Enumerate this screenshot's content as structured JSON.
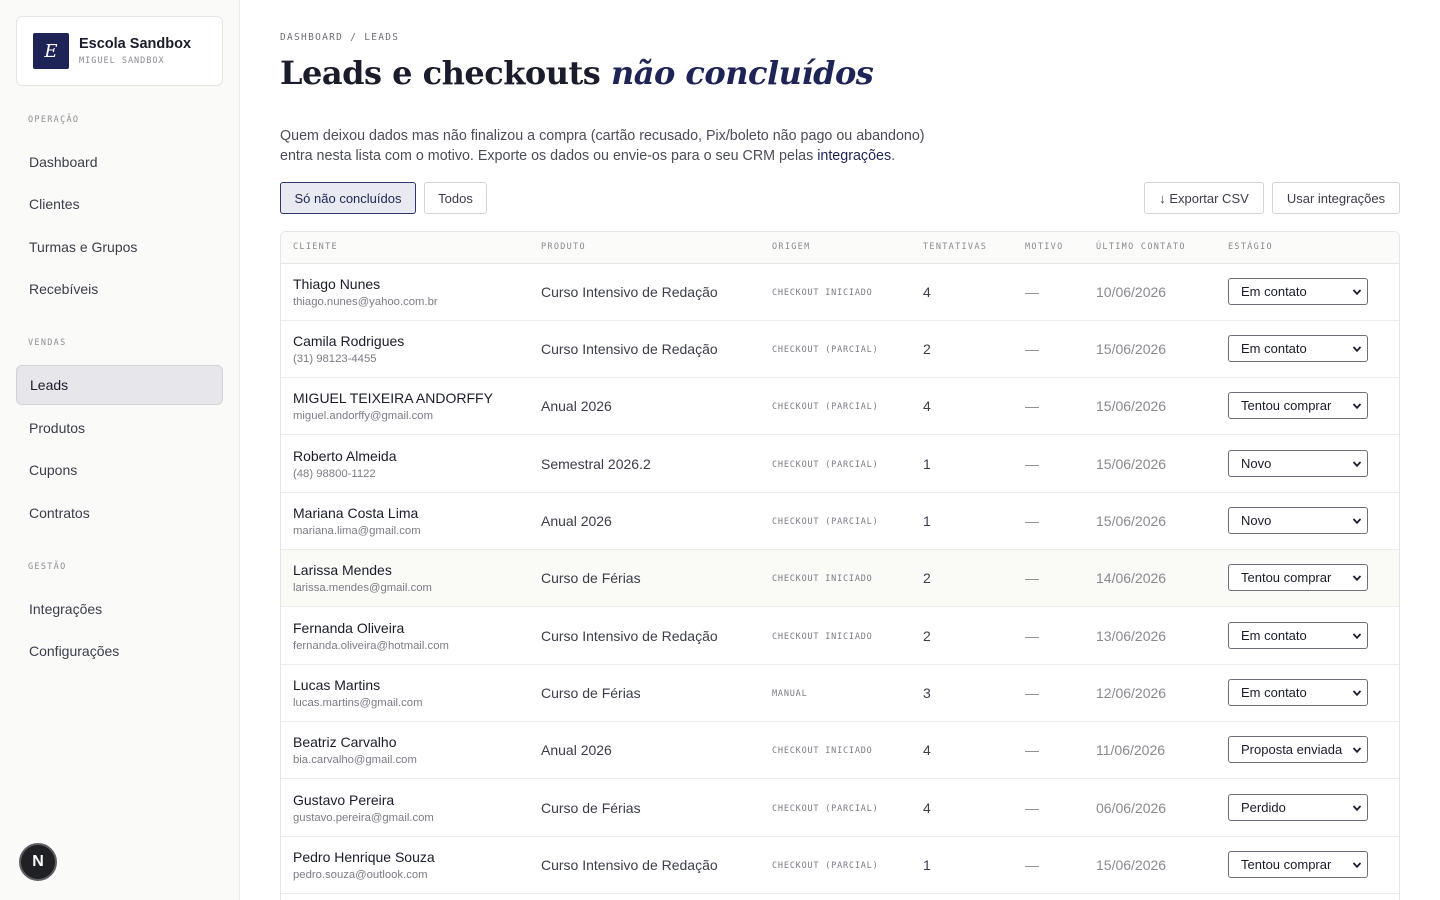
{
  "brand": {
    "initial": "E",
    "name": "Escola Sandbox",
    "sub": "MIGUEL SANDBOX"
  },
  "nav": {
    "sections": [
      {
        "label": "OPERAÇÃO",
        "items": [
          "Dashboard",
          "Clientes",
          "Turmas e Grupos",
          "Recebíveis"
        ]
      },
      {
        "label": "VENDAS",
        "items": [
          "Leads",
          "Produtos",
          "Cupons",
          "Contratos"
        ]
      },
      {
        "label": "GESTÃO",
        "items": [
          "Integrações",
          "Configurações"
        ]
      }
    ],
    "active": "Leads"
  },
  "fab": {
    "label": "N"
  },
  "page": {
    "breadcrumb": "DASHBOARD / LEADS",
    "title_main": "Leads e checkouts ",
    "title_em": "não concluídos",
    "desc_line1": "Quem deixou dados mas não finalizou a compra (cartão recusado, Pix/boleto não pago ou abandono)",
    "desc_line2": "entra nesta lista com o motivo. Exporte os dados ou envie-os para o seu CRM pelas ",
    "desc_link": "integrações",
    "desc_end": "."
  },
  "filters": {
    "only_unfinished": "Só não concluídos",
    "all": "Todos"
  },
  "actions": {
    "export": "↓ Exportar CSV",
    "integrations": "Usar integrações"
  },
  "table": {
    "headers": [
      "CLIENTE",
      "PRODUTO",
      "ORIGEM",
      "TENTATIVAS",
      "MOTIVO",
      "ÚLTIMO CONTATO",
      "ESTÁGIO"
    ],
    "rows": [
      {
        "name": "Thiago Nunes",
        "contact": "thiago.nunes@yahoo.com.br",
        "product": "Curso Intensivo de Redação",
        "origin": "CHECKOUT INICIADO",
        "attempts": "4",
        "reason": "—",
        "last": "10/06/2026",
        "stage": "Em contato"
      },
      {
        "name": "Camila Rodrigues",
        "contact": "(31) 98123-4455",
        "product": "Curso Intensivo de Redação",
        "origin": "CHECKOUT (PARCIAL)",
        "attempts": "2",
        "reason": "—",
        "last": "15/06/2026",
        "stage": "Em contato"
      },
      {
        "name": "MIGUEL TEIXEIRA ANDORFFY",
        "contact": "miguel.andorffy@gmail.com",
        "product": "Anual 2026",
        "origin": "CHECKOUT (PARCIAL)",
        "attempts": "4",
        "reason": "—",
        "last": "15/06/2026",
        "stage": "Tentou comprar"
      },
      {
        "name": "Roberto Almeida",
        "contact": "(48) 98800-1122",
        "product": "Semestral 2026.2",
        "origin": "CHECKOUT (PARCIAL)",
        "attempts": "1",
        "reason": "—",
        "last": "15/06/2026",
        "stage": "Novo"
      },
      {
        "name": "Mariana Costa Lima",
        "contact": "mariana.lima@gmail.com",
        "product": "Anual 2026",
        "origin": "CHECKOUT (PARCIAL)",
        "attempts": "1",
        "reason": "—",
        "last": "15/06/2026",
        "stage": "Novo"
      },
      {
        "name": "Larissa Mendes",
        "contact": "larissa.mendes@gmail.com",
        "product": "Curso de Férias",
        "origin": "CHECKOUT INICIADO",
        "attempts": "2",
        "reason": "—",
        "last": "14/06/2026",
        "stage": "Tentou comprar"
      },
      {
        "name": "Fernanda Oliveira",
        "contact": "fernanda.oliveira@hotmail.com",
        "product": "Curso Intensivo de Redação",
        "origin": "CHECKOUT INICIADO",
        "attempts": "2",
        "reason": "—",
        "last": "13/06/2026",
        "stage": "Em contato"
      },
      {
        "name": "Lucas Martins",
        "contact": "lucas.martins@gmail.com",
        "product": "Curso de Férias",
        "origin": "MANUAL",
        "attempts": "3",
        "reason": "—",
        "last": "12/06/2026",
        "stage": "Em contato"
      },
      {
        "name": "Beatriz Carvalho",
        "contact": "bia.carvalho@gmail.com",
        "product": "Anual 2026",
        "origin": "CHECKOUT INICIADO",
        "attempts": "4",
        "reason": "—",
        "last": "11/06/2026",
        "stage": "Proposta enviada"
      },
      {
        "name": "Gustavo Pereira",
        "contact": "gustavo.pereira@gmail.com",
        "product": "Curso de Férias",
        "origin": "CHECKOUT (PARCIAL)",
        "attempts": "4",
        "reason": "—",
        "last": "06/06/2026",
        "stage": "Perdido"
      },
      {
        "name": "Pedro Henrique Souza",
        "contact": "pedro.souza@outlook.com",
        "product": "Curso Intensivo de Redação",
        "origin": "CHECKOUT (PARCIAL)",
        "attempts": "1",
        "reason": "—",
        "last": "15/06/2026",
        "stage": "Tentou comprar"
      }
    ]
  }
}
